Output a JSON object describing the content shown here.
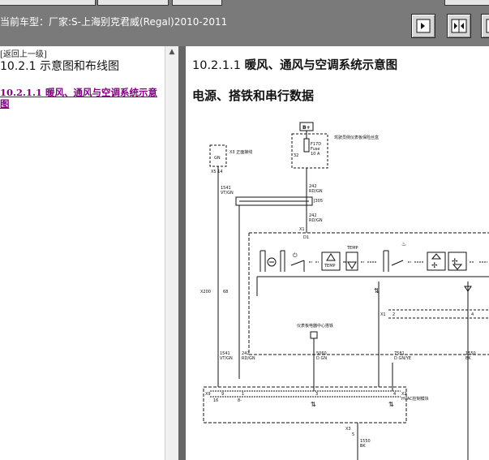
{
  "vehicle": {
    "label": "当前车型：厂家:S-上海别克君威(Regal)2010-2011"
  },
  "toolbar": {
    "buttons": [
      "single-pane-view",
      "split-pane-view",
      "panel-toggle"
    ]
  },
  "left_panel": {
    "back_link": "[返回上一级]",
    "section_title": "10.2.1 示意图和布线图",
    "sub_link": "10.2.1.1 暖风、通风与空调系统示意图"
  },
  "main": {
    "title_number": "10.2.1.1",
    "title_text": "暖风、通风与空调系统示意图",
    "subtitle": "电源、搭铁和串行数据"
  },
  "diagram": {
    "battery": "B+",
    "fuse_note": "驾驶员侧仪表板保险丝盒",
    "fuse_id": "F17D",
    "fuse_word": "Fuse",
    "fuse_rating": "10 A",
    "fuse_pin": "32",
    "left_connector_note": "X3 正面接线",
    "left_connector": "GN",
    "left_connector_pin": "X5 14",
    "wire_left_top": "1541",
    "wire_left_top_color": "VT/GN",
    "wire_fuse_out": "242",
    "wire_fuse_out_color": "RD/GN",
    "splice": "J305",
    "wire_splice_out": "242",
    "wire_splice_out_color": "RD/GN",
    "module_top_conn": "X1",
    "module_top_pin": "D1",
    "side_conn": "X200",
    "side_conn_pin": "68",
    "mid_conn": "X1",
    "mid_conn_pins": [
      "2",
      "4"
    ],
    "ground_note": "仪表板电器中心搭铁",
    "wire_b1": "1541",
    "wire_b1_color": "VT/GN",
    "wire_b2": "242",
    "wire_b2_color": "RD/GN",
    "wire_b3": "5060",
    "wire_b3_color": "D GN",
    "wire_b4": "7581",
    "wire_b4_color": "D GN/YE",
    "wire_b5": "1550",
    "wire_b5_color": "BK",
    "bottom_conn_left": "X9",
    "bottom_conn_left_pins": [
      "16",
      "9"
    ],
    "bottom_conn_pins": [
      "1",
      "8-",
      "3",
      "4"
    ],
    "bottom_conn_right": "X2",
    "bottom_module_note": "HVAC控制模块",
    "x3_label": "X3",
    "x3_pin": "5",
    "wire_bottom": "1550",
    "wire_bottom_color": "BK",
    "control_labels": [
      "TEMP",
      "TEMP"
    ]
  },
  "colors": {
    "topbar": "#7a7a7a",
    "link_visited": "#800080",
    "divider": "#666666"
  }
}
